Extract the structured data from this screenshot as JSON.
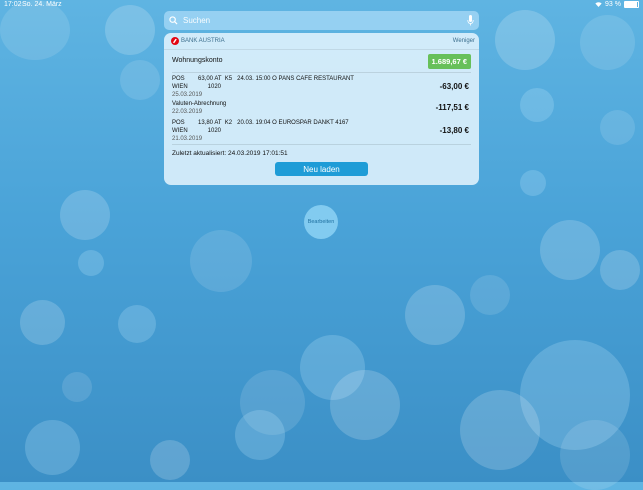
{
  "status": {
    "time": "17:02",
    "date": "So. 24. März",
    "battery": "93 %"
  },
  "search": {
    "placeholder": "Suchen"
  },
  "widget": {
    "title": "BANK AUSTRIA",
    "toggle": "Weniger",
    "account": {
      "name": "Wohnungskonto",
      "balance": "1.689,67 €"
    },
    "transactions": [
      {
        "line1": "POS        63,00 AT  K5   24.03. 15:00 O PANS CAFE RESTAURANT",
        "line2": "WIEN            1020",
        "date": "25.03.2019",
        "amount": "-63,00 €"
      },
      {
        "line1": "Valuten-Abrechnung",
        "line2": "",
        "date": "22.03.2019",
        "amount": "-117,51 €"
      },
      {
        "line1": "POS        13,80 AT  K2   20.03. 19:04 O EUROSPAR DANKT 4167",
        "line2": "WIEN            1020",
        "date": "21.03.2019",
        "amount": "-13,80 €"
      }
    ],
    "updated": "Zuletzt aktualisiert: 24.03.2019 17:01:51",
    "reload": "Neu laden"
  },
  "edit": "Bearbeiten",
  "colors": {
    "accent": "#1e9cd7",
    "balance_bg": "#67c05a",
    "brand": "#e30613"
  }
}
